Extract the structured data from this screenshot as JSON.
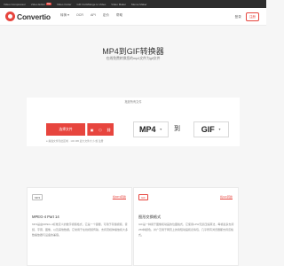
{
  "topbar": {
    "items": [
      {
        "label": "Video Compressor"
      },
      {
        "label": "Video Editor",
        "badge": "Hot"
      },
      {
        "label": "Video Cutter"
      },
      {
        "label": "GIF Cut&Merge to Video"
      },
      {
        "label": "Video Maker"
      },
      {
        "label": "Meme Maker"
      }
    ]
  },
  "navbar": {
    "logo_text": "Convertio",
    "links": [
      "转换 ▾",
      "OCR",
      "API",
      "定价",
      "帮助"
    ],
    "login": "登录",
    "signup": "注册"
  },
  "hero": {
    "title": "MP4到GIF转换器",
    "subtitle": "在线免费转换您的mp4文件为gif文件"
  },
  "converter": {
    "label": "拖放所有文件",
    "choose_label": "选择文件",
    "drop_hint": "● 拖拽文件到此区域 · 100 MB 最大文件大小 或 注册",
    "from_format": "MP4",
    "to_word": "到",
    "to_format": "GIF",
    "caret": "▼",
    "source_icons": [
      "▣",
      "⬡",
      "⛓"
    ],
    "accent": "#e7453e"
  },
  "cards": {
    "left": {
      "tag": "MP4",
      "link": "将MP4转换",
      "title": "MPEG-4 Part 14",
      "text": "MP4是由MPEG-4标准定义的数字视频格式，它是一个容器，可用于存储视频、音频、字幕、图像，以及其他数据。它常用于在线视频传输，支持流媒体播放和大多数播放器与设备的兼容。"
    },
    "right": {
      "tag": "GIF",
      "link": "将GIF转换",
      "title": "图形交换格式",
      "text": "GIF是一种用于图像和动画的位图格式，它使用LZW无损压缩算法，每帧最多支持256种颜色，并广泛用于网页上的简短动画和表情包，几乎所有浏览器都支持该格式。"
    }
  }
}
